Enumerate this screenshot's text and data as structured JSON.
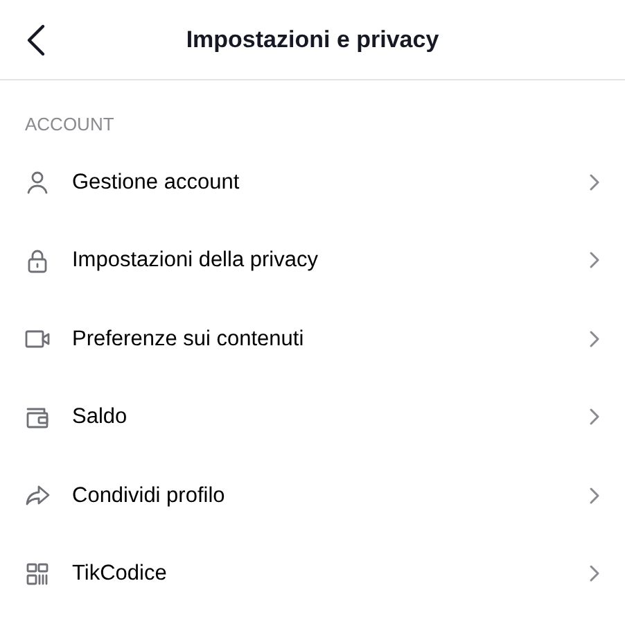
{
  "header": {
    "title": "Impostazioni e privacy"
  },
  "section": {
    "title": "ACCOUNT",
    "items": [
      {
        "kind": "person",
        "label": "Gestione account"
      },
      {
        "kind": "lock",
        "label": "Impostazioni della privacy"
      },
      {
        "kind": "video",
        "label": "Preferenze sui contenuti"
      },
      {
        "kind": "wallet",
        "label": "Saldo"
      },
      {
        "kind": "share",
        "label": "Condividi profilo"
      },
      {
        "kind": "qr",
        "label": "TikCodice"
      }
    ]
  }
}
